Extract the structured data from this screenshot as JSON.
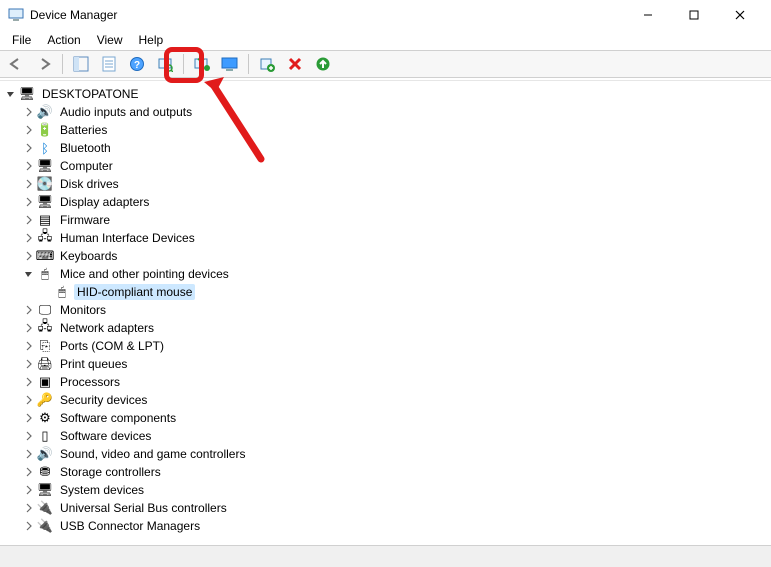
{
  "window": {
    "title": "Device Manager"
  },
  "menu": {
    "file": "File",
    "action": "Action",
    "view": "View",
    "help": "Help"
  },
  "root": {
    "label": "DESKTOPATONE"
  },
  "categories": [
    {
      "label": "Audio inputs and outputs",
      "icon": "🔊"
    },
    {
      "label": "Batteries",
      "icon": "🔋"
    },
    {
      "label": "Bluetooth",
      "icon": "ᛒ",
      "iconColor": "#0078d7"
    },
    {
      "label": "Computer",
      "icon": "🖥"
    },
    {
      "label": "Disk drives",
      "icon": "💽"
    },
    {
      "label": "Display adapters",
      "icon": "🖥"
    },
    {
      "label": "Firmware",
      "icon": "▤"
    },
    {
      "label": "Human Interface Devices",
      "icon": "🖧"
    },
    {
      "label": "Keyboards",
      "icon": "⌨"
    },
    {
      "label": "Mice and other pointing devices",
      "icon": "🖱",
      "expanded": true,
      "children": [
        {
          "label": "HID-compliant mouse",
          "icon": "🖱",
          "selected": true
        }
      ]
    },
    {
      "label": "Monitors",
      "icon": "🖵"
    },
    {
      "label": "Network adapters",
      "icon": "🖧"
    },
    {
      "label": "Ports (COM & LPT)",
      "icon": "⎘"
    },
    {
      "label": "Print queues",
      "icon": "🖨"
    },
    {
      "label": "Processors",
      "icon": "▣"
    },
    {
      "label": "Security devices",
      "icon": "🔑"
    },
    {
      "label": "Software components",
      "icon": "⚙"
    },
    {
      "label": "Software devices",
      "icon": "▯"
    },
    {
      "label": "Sound, video and game controllers",
      "icon": "🔊"
    },
    {
      "label": "Storage controllers",
      "icon": "⛃"
    },
    {
      "label": "System devices",
      "icon": "🖥"
    },
    {
      "label": "Universal Serial Bus controllers",
      "icon": "🔌"
    },
    {
      "label": "USB Connector Managers",
      "icon": "🔌"
    }
  ],
  "toolbar": {
    "back": "←",
    "forward": "→",
    "buttons": [
      "show-hide-console-tree",
      "properties",
      "help",
      "scan-hardware",
      "update-driver",
      "uninstall",
      "add-legacy",
      "disable",
      "enable"
    ],
    "highlighted": "update-driver"
  }
}
